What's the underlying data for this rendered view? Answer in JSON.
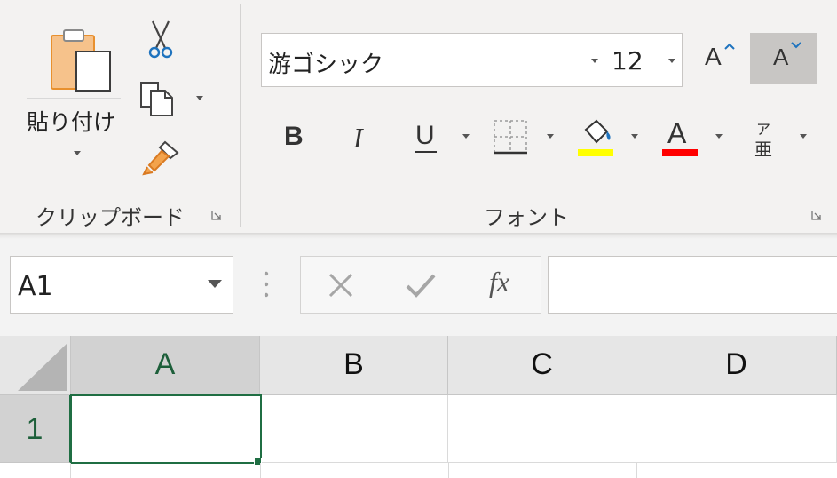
{
  "ribbon": {
    "clipboard": {
      "paste_label": "貼り付け",
      "group_label": "クリップボード"
    },
    "font": {
      "font_name": "游ゴシック",
      "font_size": "12",
      "group_label": "フォント",
      "bold_label": "B",
      "italic_label": "I",
      "underline_label": "U",
      "font_color_glyph": "A",
      "grow_glyph": "A",
      "shrink_glyph": "A",
      "phonetic_top": "ア",
      "phonetic_bottom": "亜",
      "highlight_color": "#ffff00",
      "font_color": "#ff0000"
    }
  },
  "formula_bar": {
    "name_box": "A1",
    "fx_label": "fx",
    "formula": ""
  },
  "grid": {
    "columns": [
      "A",
      "B",
      "C",
      "D"
    ],
    "rows": [
      "1"
    ],
    "active_cell": "A1",
    "accent": "#1f6e43"
  }
}
